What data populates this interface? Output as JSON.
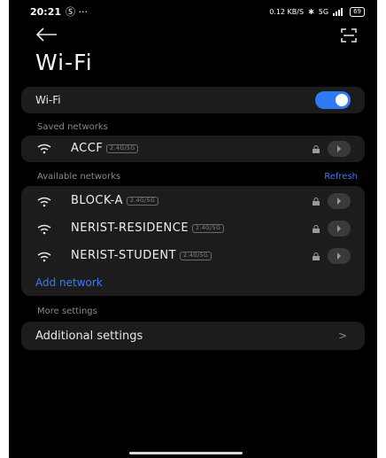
{
  "status_bar": {
    "time": "20:21",
    "left_icons": "Ⓢ ···",
    "network_speed": "0.12 KB/S",
    "signal_text": "5G",
    "battery": "69"
  },
  "header": {
    "title": "Wi-Fi"
  },
  "wifi_toggle": {
    "label": "Wi-Fi",
    "enabled": true
  },
  "saved_networks": {
    "label": "Saved networks",
    "items": [
      {
        "name": "ACCF",
        "band": "2.4G/5G"
      }
    ]
  },
  "available_networks": {
    "label": "Available networks",
    "refresh_label": "Refresh",
    "items": [
      {
        "name": "BLOCK-A",
        "band": "2.4G/5G"
      },
      {
        "name": "NERIST-RESIDENCE",
        "band": "2.4G/5G"
      },
      {
        "name": "NERIST-STUDENT",
        "band": "2.4G/5G"
      }
    ],
    "add_network_label": "Add network"
  },
  "more_settings": {
    "label": "More settings",
    "additional_settings_label": "Additional settings",
    "chevron": ">"
  },
  "colors": {
    "accent": "#2f7af5",
    "link": "#3a7cf2",
    "card_bg": "#1c1c1c",
    "background": "#000000"
  }
}
